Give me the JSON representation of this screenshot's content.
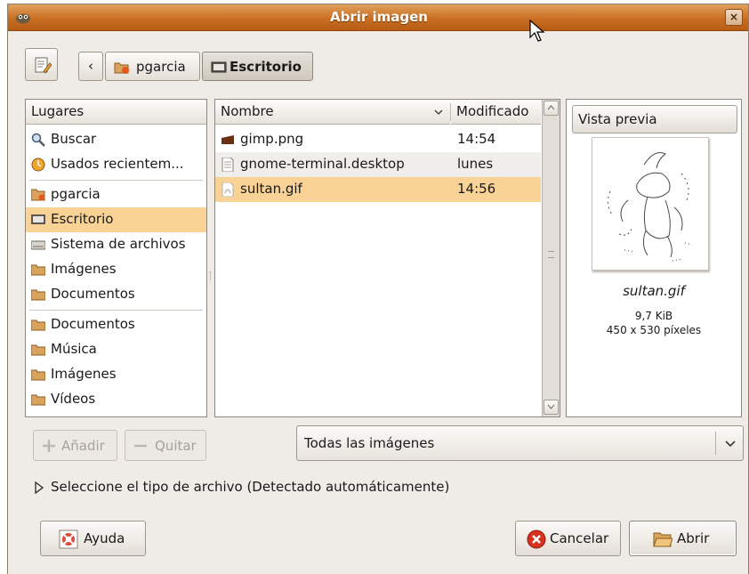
{
  "window": {
    "title": "Abrir imagen",
    "close_glyph": "×"
  },
  "pathbar": {
    "back_glyph": "‹",
    "crumbs": [
      {
        "label": "pgarcia",
        "icon": "home-folder-icon"
      },
      {
        "label": "Escritorio",
        "icon": "desktop-icon"
      }
    ]
  },
  "places": {
    "header": "Lugares",
    "items": [
      {
        "label": "Buscar",
        "icon": "search-icon"
      },
      {
        "label": "Usados recientem...",
        "icon": "recent-icon"
      },
      {
        "label": "pgarcia",
        "icon": "home-folder-icon"
      },
      {
        "label": "Escritorio",
        "icon": "desktop-icon",
        "selected": true
      },
      {
        "label": "Sistema de archivos",
        "icon": "drive-icon"
      },
      {
        "label": "Imágenes",
        "icon": "folder-icon"
      },
      {
        "label": "Documentos",
        "icon": "folder-icon"
      },
      {
        "label": "Documentos",
        "icon": "folder-icon"
      },
      {
        "label": "Música",
        "icon": "folder-icon"
      },
      {
        "label": "Imágenes",
        "icon": "folder-icon"
      },
      {
        "label": "Vídeos",
        "icon": "folder-icon"
      }
    ]
  },
  "files": {
    "col_name": "Nombre",
    "col_modified": "Modificado",
    "rows": [
      {
        "name": "gimp.png",
        "modified": "14:54",
        "icon": "image-file-icon"
      },
      {
        "name": "gnome-terminal.desktop",
        "modified": "lunes",
        "icon": "text-file-icon"
      },
      {
        "name": "sultan.gif",
        "modified": "14:56",
        "icon": "gif-file-icon",
        "selected": true
      }
    ]
  },
  "preview": {
    "header": "Vista previa",
    "filename": "sultan.gif",
    "size": "9,7 KiB",
    "dimensions": "450 x 530 píxeles"
  },
  "actions": {
    "add_label": "Añadir",
    "remove_label": "Quitar",
    "filter_value": "Todas las imágenes",
    "expander_label": "Seleccione el tipo de archivo (Detectado automáticamente)",
    "help_label": "Ayuda",
    "cancel_label": "Cancelar",
    "open_label": "Abrir"
  },
  "colors": {
    "selection": "#f8d395",
    "titlebar": "#c96e21"
  }
}
